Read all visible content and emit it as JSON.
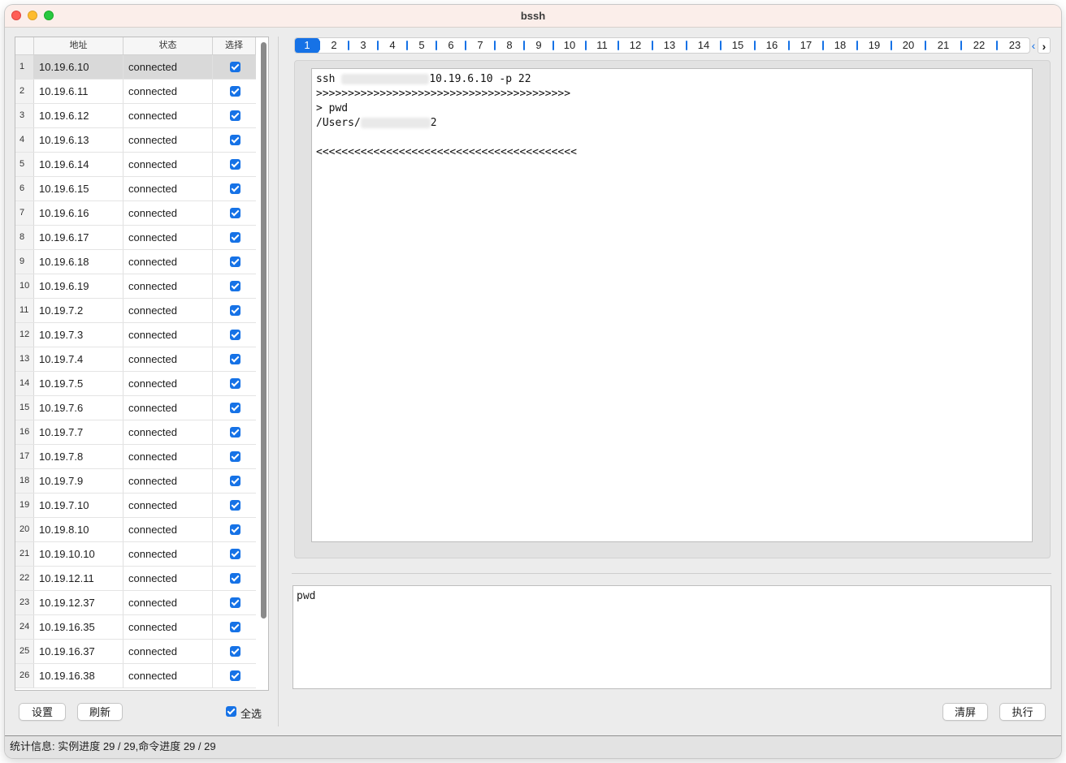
{
  "window": {
    "title": "bssh"
  },
  "table": {
    "headers": {
      "address": "地址",
      "status": "状态",
      "select": "选择"
    },
    "rows": [
      {
        "num": "1",
        "ip": "10.19.6.10",
        "status": "connected",
        "checked": true
      },
      {
        "num": "2",
        "ip": "10.19.6.11",
        "status": "connected",
        "checked": true
      },
      {
        "num": "3",
        "ip": "10.19.6.12",
        "status": "connected",
        "checked": true
      },
      {
        "num": "4",
        "ip": "10.19.6.13",
        "status": "connected",
        "checked": true
      },
      {
        "num": "5",
        "ip": "10.19.6.14",
        "status": "connected",
        "checked": true
      },
      {
        "num": "6",
        "ip": "10.19.6.15",
        "status": "connected",
        "checked": true
      },
      {
        "num": "7",
        "ip": "10.19.6.16",
        "status": "connected",
        "checked": true
      },
      {
        "num": "8",
        "ip": "10.19.6.17",
        "status": "connected",
        "checked": true
      },
      {
        "num": "9",
        "ip": "10.19.6.18",
        "status": "connected",
        "checked": true
      },
      {
        "num": "10",
        "ip": "10.19.6.19",
        "status": "connected",
        "checked": true
      },
      {
        "num": "11",
        "ip": "10.19.7.2",
        "status": "connected",
        "checked": true
      },
      {
        "num": "12",
        "ip": "10.19.7.3",
        "status": "connected",
        "checked": true
      },
      {
        "num": "13",
        "ip": "10.19.7.4",
        "status": "connected",
        "checked": true
      },
      {
        "num": "14",
        "ip": "10.19.7.5",
        "status": "connected",
        "checked": true
      },
      {
        "num": "15",
        "ip": "10.19.7.6",
        "status": "connected",
        "checked": true
      },
      {
        "num": "16",
        "ip": "10.19.7.7",
        "status": "connected",
        "checked": true
      },
      {
        "num": "17",
        "ip": "10.19.7.8",
        "status": "connected",
        "checked": true
      },
      {
        "num": "18",
        "ip": "10.19.7.9",
        "status": "connected",
        "checked": true
      },
      {
        "num": "19",
        "ip": "10.19.7.10",
        "status": "connected",
        "checked": true
      },
      {
        "num": "20",
        "ip": "10.19.8.10",
        "status": "connected",
        "checked": true
      },
      {
        "num": "21",
        "ip": "10.19.10.10",
        "status": "connected",
        "checked": true
      },
      {
        "num": "22",
        "ip": "10.19.12.11",
        "status": "connected",
        "checked": true
      },
      {
        "num": "23",
        "ip": "10.19.12.37",
        "status": "connected",
        "checked": true
      },
      {
        "num": "24",
        "ip": "10.19.16.35",
        "status": "connected",
        "checked": true
      },
      {
        "num": "25",
        "ip": "10.19.16.37",
        "status": "connected",
        "checked": true
      },
      {
        "num": "26",
        "ip": "10.19.16.38",
        "status": "connected",
        "checked": true
      }
    ]
  },
  "left_buttons": {
    "settings": "设置",
    "refresh": "刷新",
    "select_all": "全选"
  },
  "tabs": [
    "1",
    "2",
    "3",
    "4",
    "5",
    "6",
    "7",
    "8",
    "9",
    "10",
    "11",
    "12",
    "13",
    "14",
    "15",
    "16",
    "17",
    "18",
    "19",
    "20",
    "21",
    "22",
    "23"
  ],
  "active_tab": "1",
  "terminal": {
    "line1_prefix": "ssh ",
    "line1_suffix": "10.19.6.10 -p 22",
    "line2": ">>>>>>>>>>>>>>>>>>>>>>>>>>>>>>>>>>>>>>>>",
    "line3": "> pwd",
    "line4_prefix": "/Users/",
    "line4_suffix": "2",
    "line6": "<<<<<<<<<<<<<<<<<<<<<<<<<<<<<<<<<<<<<<<<<"
  },
  "command_input": {
    "value": "pwd"
  },
  "right_buttons": {
    "clear": "清屏",
    "execute": "执行"
  },
  "status_bar": {
    "text": "统计信息: 实例进度 29 / 29,命令进度 29 / 29"
  },
  "colors": {
    "accent": "#1672e6",
    "titlebar": "#fbeeea"
  }
}
